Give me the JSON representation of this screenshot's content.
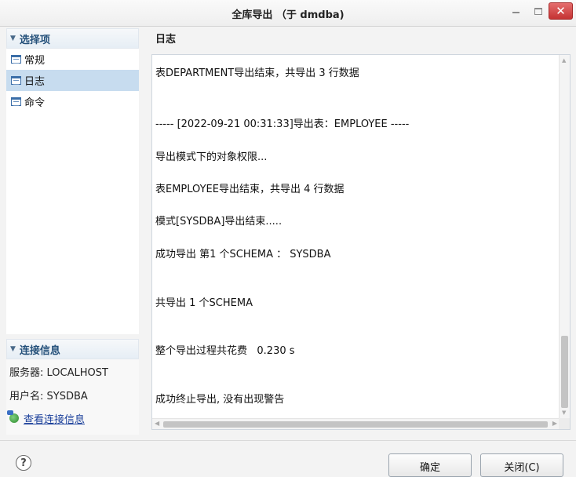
{
  "window": {
    "title": "全库导出 （于 dmdba)",
    "close_glyph": "✕"
  },
  "sidebar": {
    "options_header": "选择项",
    "items": [
      {
        "label": "常规"
      },
      {
        "label": "日志",
        "selected": true
      },
      {
        "label": "命令"
      }
    ],
    "connection_header": "连接信息",
    "server": "服务器: LOCALHOST",
    "user": "用户名: SYSDBA",
    "view_link": "查看连接信息"
  },
  "log": {
    "title": "日志",
    "lines": [
      "表DEPARTMENT导出结束，共导出 3 行数据",
      "----- [2022-09-21 00:31:33]导出表：EMPLOYEE -----",
      "导出模式下的对象权限...",
      "表EMPLOYEE导出结束，共导出 4 行数据",
      "模式[SYSDBA]导出结束.....",
      "成功导出 第1 个SCHEMA ： SYSDBA",
      "共导出 1 个SCHEMA",
      "整个导出过程共花费   0.230 s",
      "成功终止导出, 没有出现警告"
    ]
  },
  "buttons": {
    "help": "?",
    "ok": "确定",
    "close": "关闭(C)"
  },
  "icons": {
    "collapse": "triangle-down-icon",
    "item": "document-list-icon",
    "link": "connection-info-icon",
    "help": "help-icon"
  },
  "colors": {
    "selection": "#c7dcef",
    "section_header_text": "#24507a",
    "close_button": "#c53333",
    "link": "#1a3f9a"
  }
}
